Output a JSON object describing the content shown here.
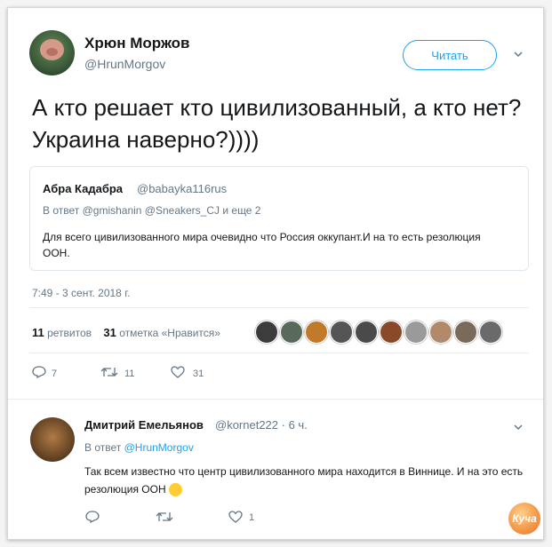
{
  "tweet": {
    "author_name": "Хрюн Моржов",
    "author_handle": "@HrunMorgov",
    "follow_label": "Читать",
    "text": "А кто решает кто цивилизованный, а кто нет? Украина наверно?))))",
    "date": "7:49 - 3 сент. 2018 г."
  },
  "quote": {
    "name": "Абра Кадабра",
    "handle": "@babayka116rus",
    "reply_to": "В ответ @gmishanin @Sneakers_CJ и еще 2",
    "text": "Для всего цивилизованного мира очевидно что Россия оккупант.И на то есть резолюция ООН."
  },
  "stats": {
    "retweets_count": "11",
    "retweets_label": "ретвитов",
    "likes_count": "31",
    "likes_label": "отметка «Нравится»"
  },
  "actions": {
    "reply_count": "7",
    "retweet_count": "11",
    "like_count": "31"
  },
  "reply": {
    "name": "Дмитрий Емельянов",
    "handle": "@kornet222 · 6 ч.",
    "reply_prefix": "В ответ",
    "reply_to_handle": "@HrunMorgov",
    "text": "Так всем известно что центр цивилизованного мира находится в Виннице. И на это есть резолюция ООН",
    "like_count": "1"
  },
  "watermark": "Куча",
  "colors": {
    "accent": "#1da1f2",
    "text": "#14171a",
    "muted": "#657786"
  }
}
